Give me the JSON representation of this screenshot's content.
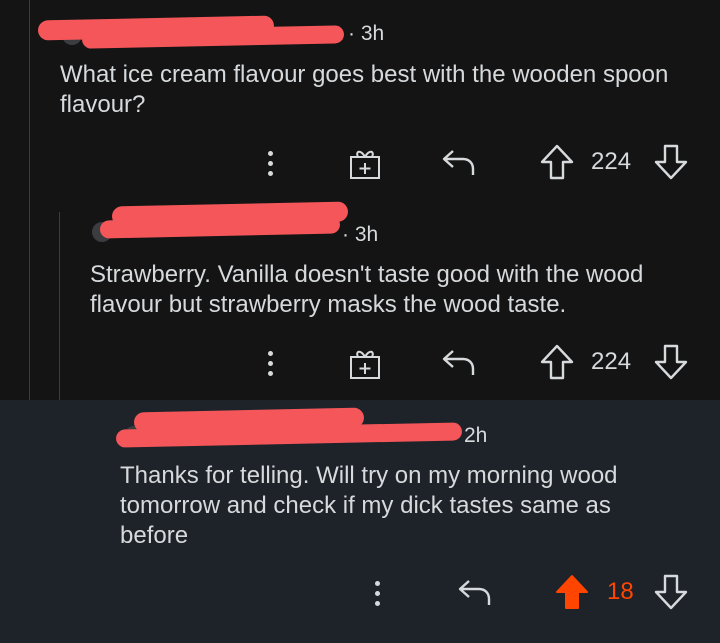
{
  "comments": [
    {
      "time": "3h",
      "text": "What ice cream flavour goes best with the wooden spoon flavour?",
      "votes": "224",
      "award": true
    },
    {
      "time": "3h",
      "text": "Strawberry. Vanilla doesn't taste good with the wood flavour but strawberry masks the wood taste.",
      "votes": "224",
      "award": true
    },
    {
      "time": "2h",
      "text": "Thanks for telling. Will try on my morning wood tomorrow and check if my dick tastes same as before",
      "votes": "18",
      "award": false,
      "upvoted": true
    }
  ],
  "colors": {
    "background": "#141414",
    "highlight": "#1e232a",
    "text": "#d7dadc",
    "upvote_active": "#ff4500",
    "redaction": "#f4565a"
  },
  "icons": [
    "more-icon",
    "award-icon",
    "reply-icon",
    "upvote-icon",
    "downvote-icon"
  ]
}
